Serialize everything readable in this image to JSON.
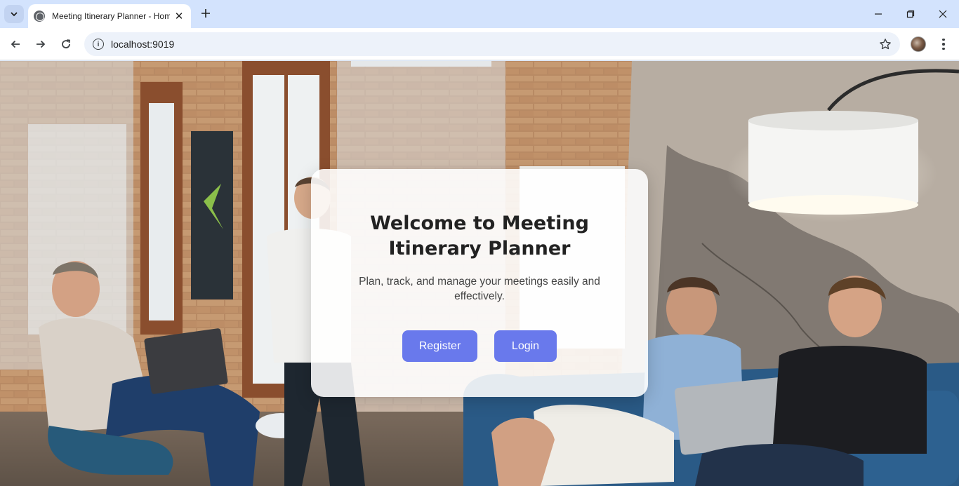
{
  "browser": {
    "tab": {
      "title": "Meeting Itinerary Planner - Home",
      "favicon": "globe-icon"
    },
    "url": "localhost:9019",
    "icons": {
      "tab_search": "chevron-down-icon",
      "new_tab": "plus-icon",
      "back": "arrow-left-icon",
      "forward": "arrow-right-icon",
      "reload": "reload-icon",
      "site_info": "info-icon",
      "bookmark": "star-icon",
      "menu": "kebab-menu-icon"
    }
  },
  "page": {
    "title": "Welcome to Meeting Itinerary Planner",
    "subtitle": "Plan, track, and manage your meetings easily and effectively.",
    "buttons": {
      "register": "Register",
      "login": "Login"
    }
  },
  "colors": {
    "accent": "#6979ec",
    "tabstrip": "#d3e3fd",
    "omnibox": "#edf2fa"
  }
}
